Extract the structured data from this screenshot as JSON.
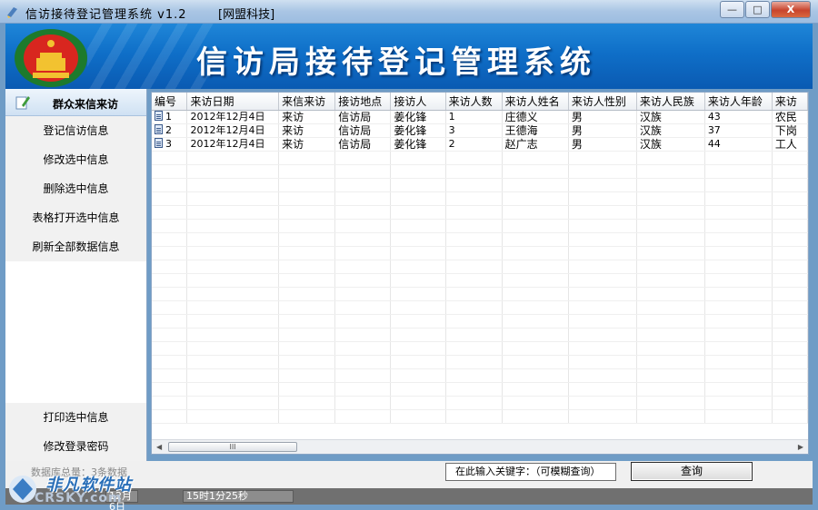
{
  "window": {
    "title": "信访接待登记管理系统 v1.2",
    "company": "[网盟科技]",
    "buttons": {
      "minimize": "—",
      "maximize": "□",
      "close": "X"
    }
  },
  "banner": {
    "title": "信访局接待登记管理系统"
  },
  "sidebar": {
    "header": "群众来信来访",
    "items": [
      {
        "label": "登记信访信息"
      },
      {
        "label": "修改选中信息"
      },
      {
        "label": "删除选中信息"
      },
      {
        "label": "表格打开选中信息"
      },
      {
        "label": "刷新全部数据信息"
      }
    ],
    "bottom_items": [
      {
        "label": "打印选中信息"
      },
      {
        "label": "修改登录密码"
      }
    ]
  },
  "grid": {
    "columns": [
      "编号",
      "来访日期",
      "来信来访",
      "接访地点",
      "接访人",
      "来访人数",
      "来访人姓名",
      "来访人性别",
      "来访人民族",
      "来访人年龄",
      "来访"
    ],
    "rows": [
      [
        "1",
        "2012年12月4日",
        "来访",
        "信访局",
        "姜化锋",
        "1",
        "庄德义",
        "男",
        "汉族",
        "43",
        "农民"
      ],
      [
        "2",
        "2012年12月4日",
        "来访",
        "信访局",
        "姜化锋",
        "3",
        "王德海",
        "男",
        "汉族",
        "37",
        "下岗"
      ],
      [
        "3",
        "2012年12月4日",
        "来访",
        "信访局",
        "姜化锋",
        "2",
        "赵广志",
        "男",
        "汉族",
        "44",
        "工人"
      ]
    ],
    "scroll_thumb": "III"
  },
  "bottom": {
    "db_total": "数据库总量：3条数据",
    "search_label": "在此输入关键字：（可模糊查询）",
    "query_button": "查询"
  },
  "status": {
    "date": "12月6日",
    "time": "15时1分25秒"
  },
  "watermark": {
    "text": "非凡软件站",
    "sub": "CRSKY.com"
  }
}
